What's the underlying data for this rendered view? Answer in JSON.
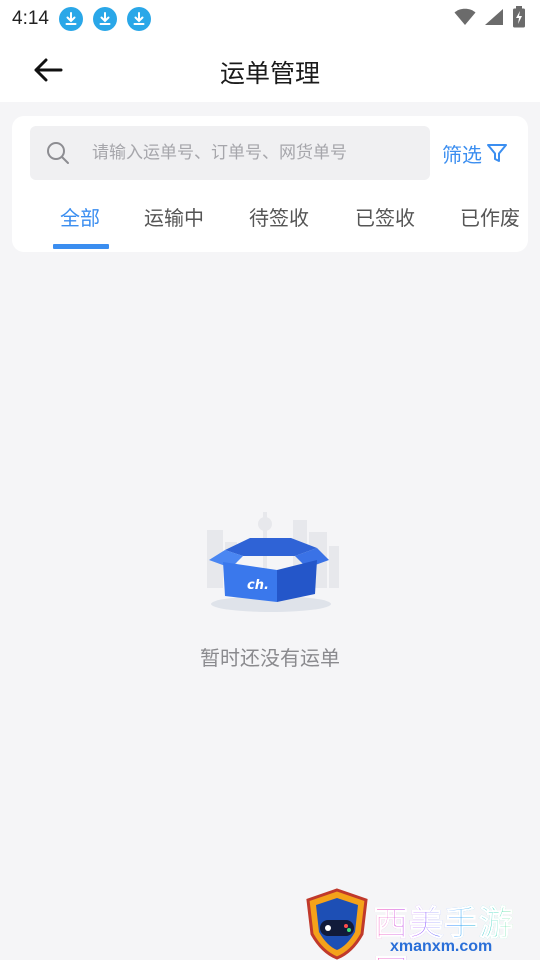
{
  "status_bar": {
    "time": "4:14",
    "notifications": [
      "download-icon",
      "download-icon",
      "download-icon"
    ],
    "right_icons": [
      "wifi-icon",
      "signal-icon",
      "battery-charging-icon"
    ]
  },
  "nav": {
    "title": "运单管理",
    "back_icon": "arrow-left-icon"
  },
  "search": {
    "placeholder": "请输入运单号、订单号、网货单号",
    "value": ""
  },
  "filter": {
    "label": "筛选",
    "icon": "funnel-icon"
  },
  "tabs": [
    {
      "label": "全部",
      "active": true
    },
    {
      "label": "运输中",
      "active": false
    },
    {
      "label": "待签收",
      "active": false
    },
    {
      "label": "已签收",
      "active": false
    },
    {
      "label": "已作废",
      "active": false
    }
  ],
  "empty_state": {
    "illustration": "empty-box-icon",
    "message": "暂时还没有运单"
  },
  "watermark": {
    "brand": "西美手游网",
    "url": "xmanxm.com"
  },
  "colors": {
    "accent": "#3b8ef0",
    "background": "#f5f5f7",
    "status_icon": "#2aa7e8"
  }
}
